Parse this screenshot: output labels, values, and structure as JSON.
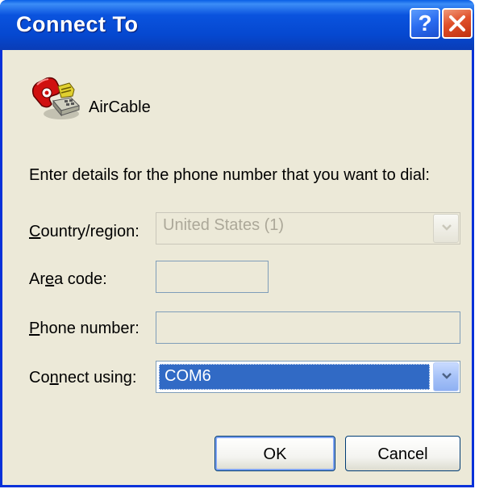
{
  "window": {
    "title": "Connect To",
    "help_glyph": "?",
    "close_icon": "close-icon"
  },
  "connection": {
    "icon": "phone-icon",
    "name": "AirCable"
  },
  "instructions": "Enter details for the phone number that you want to dial:",
  "form": {
    "country": {
      "label_pre": "",
      "label_mnemonic": "C",
      "label_post": "ountry/region:",
      "value": "United States (1)",
      "disabled": true
    },
    "area_code": {
      "label_pre": "Ar",
      "label_mnemonic": "e",
      "label_post": "a code:",
      "value": ""
    },
    "phone_number": {
      "label_pre": "",
      "label_mnemonic": "P",
      "label_post": "hone number:",
      "value": ""
    },
    "connect_using": {
      "label_pre": "Co",
      "label_mnemonic": "n",
      "label_post": "nect using:",
      "value": "COM6"
    }
  },
  "buttons": {
    "ok": "OK",
    "cancel": "Cancel"
  },
  "colors": {
    "selection": "#316ac5",
    "titlebar": "#0a53de",
    "close_button": "#e0502a",
    "dialog_bg": "#ece9d8"
  }
}
